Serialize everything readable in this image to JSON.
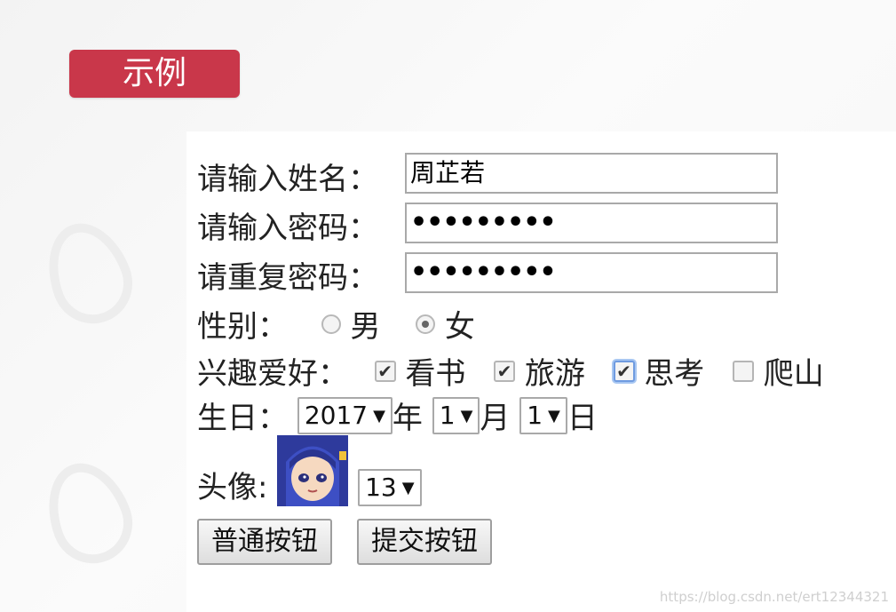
{
  "badge": {
    "label": "示例"
  },
  "form": {
    "name": {
      "label": "请输入姓名：",
      "value": "周芷若"
    },
    "password": {
      "label": "请输入密码：",
      "value": "•••••••••"
    },
    "confirm": {
      "label": "请重复密码：",
      "value": "•••••••••"
    },
    "gender": {
      "label": "性别：",
      "options": [
        {
          "label": "男",
          "checked": false
        },
        {
          "label": "女",
          "checked": true
        }
      ]
    },
    "hobbies": {
      "label": "兴趣爱好：",
      "options": [
        {
          "label": "看书",
          "checked": true
        },
        {
          "label": "旅游",
          "checked": true
        },
        {
          "label": "思考",
          "checked": true
        },
        {
          "label": "爬山",
          "checked": false
        }
      ]
    },
    "birthday": {
      "label": "生日：",
      "year": "2017",
      "year_unit": "年",
      "month": "1",
      "month_unit": "月",
      "day": "1",
      "day_unit": "日"
    },
    "avatar": {
      "label": "头像:",
      "selected": "13"
    },
    "buttons": {
      "normal": "普通按钮",
      "submit": "提交按钮"
    }
  },
  "footer": {
    "credit": "https://blog.csdn.net/ert12344321"
  }
}
